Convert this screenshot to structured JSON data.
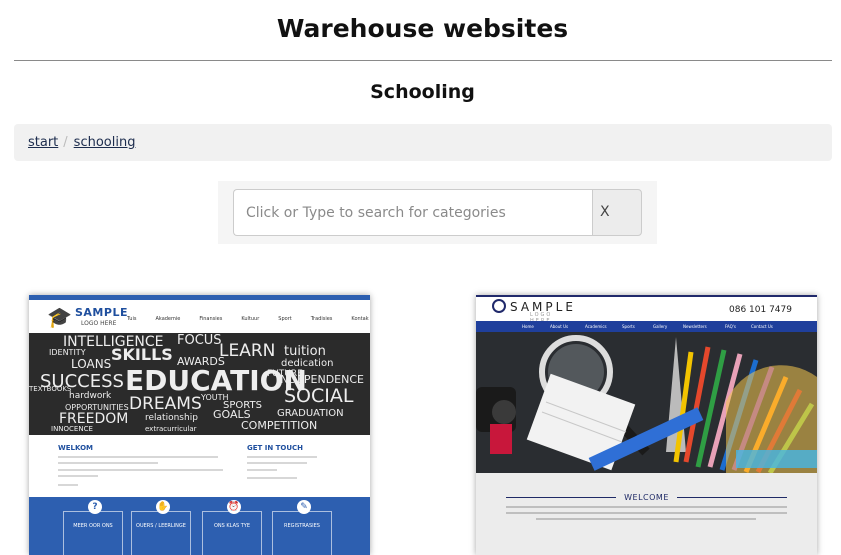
{
  "site": {
    "title": "Warehouse websites"
  },
  "page": {
    "title": "Schooling"
  },
  "breadcrumb": {
    "items": [
      "start",
      "schooling"
    ]
  },
  "search": {
    "placeholder": "Click or Type to search for categories",
    "clear_label": "X"
  },
  "thumb1": {
    "logo_name": "SAMPLE",
    "logo_sub": "LOGO HERE",
    "nav": [
      "Tuis",
      "Akademie",
      "Finansies",
      "Kultuur",
      "Sport",
      "Tradisies",
      "Kontak"
    ],
    "heading_left": "WELKOM",
    "heading_right": "GET IN TOUCH",
    "boxes": [
      "MEER OOR ONS",
      "OUERS / LEERLINGE",
      "ONS KLAS TYE",
      "REGISTRASIES"
    ],
    "hero_words": [
      "INTELLIGENCE",
      "FOCUS",
      "IDENTITY",
      "SKILLS",
      "LEARN",
      "tuition",
      "LOANS",
      "AWARDS",
      "dedication",
      "SUCCESS",
      "EDUCATION",
      "INDEPENDENCE",
      "hardwork",
      "SOCIAL",
      "OPPORTUNITIES",
      "DREAMS",
      "SPORTS",
      "FREEDOM",
      "relationship",
      "GRADUATION",
      "INNOCENCE",
      "extracurricular",
      "COMPETITION",
      "FUTURE",
      "YOUTH",
      "GOALS",
      "TEXTBOOKS"
    ]
  },
  "thumb2": {
    "logo_name": "SAMPLE",
    "logo_sub": "LOGO HERE",
    "call": "086 101 7479",
    "nav": [
      "Home",
      "About Us",
      "Academics",
      "Sports",
      "Gallery",
      "Newsletters",
      "FAQ's",
      "Contact Us"
    ],
    "welcome": "WELCOME"
  }
}
